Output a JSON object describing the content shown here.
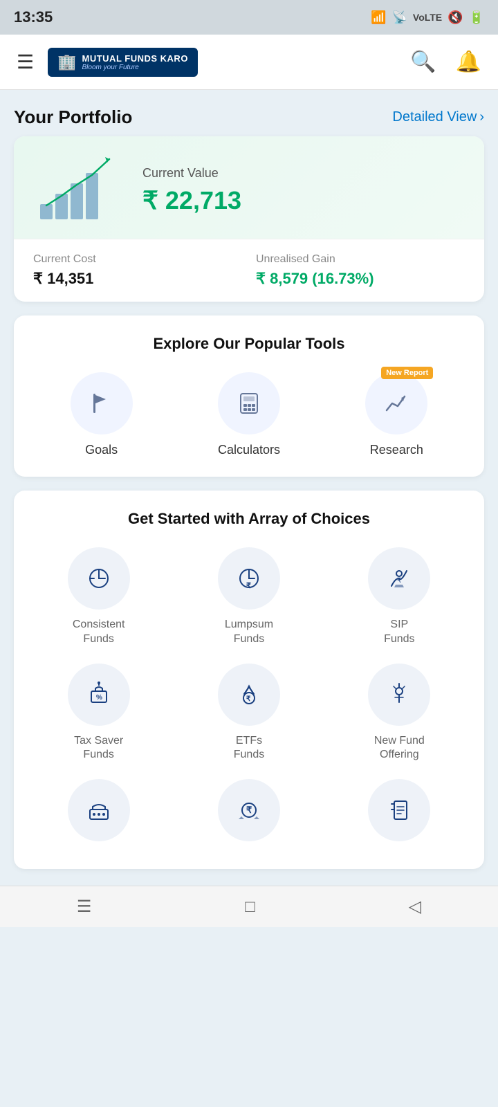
{
  "statusBar": {
    "time": "13:35",
    "icons": [
      "signal",
      "wifi",
      "lte",
      "mute",
      "battery"
    ]
  },
  "topNav": {
    "logoName": "MUTUAL FUNDS KARO",
    "logoTagline": "Bloom your Future",
    "hamburgerLabel": "≡",
    "searchLabel": "🔍",
    "bellLabel": "🔔"
  },
  "portfolio": {
    "sectionTitle": "Your Portfolio",
    "detailedView": "Detailed View",
    "currentValueLabel": "Current Value",
    "currentValue": "₹ 22,713",
    "currentCostLabel": "Current Cost",
    "currentCost": "₹ 14,351",
    "unrealisedGainLabel": "Unrealised Gain",
    "unrealisedGain": "₹ 8,579 (16.73%)"
  },
  "tools": {
    "sectionTitle": "Explore Our Popular Tools",
    "items": [
      {
        "id": "goals",
        "label": "Goals",
        "icon": "🚩",
        "badge": null
      },
      {
        "id": "calculators",
        "label": "Calculators",
        "icon": "📊",
        "badge": null
      },
      {
        "id": "research",
        "label": "Research",
        "icon": "📈",
        "badge": "New Report"
      }
    ]
  },
  "choices": {
    "sectionTitle": "Get Started with Array of Choices",
    "items": [
      {
        "id": "consistent-funds",
        "label": "Consistent Funds",
        "icon": "📉"
      },
      {
        "id": "lumpsum-funds",
        "label": "Lumpsum Funds",
        "icon": "⏱"
      },
      {
        "id": "sip-funds",
        "label": "SIP Funds",
        "icon": "🙌"
      },
      {
        "id": "tax-saver",
        "label": "Tax Saver Funds",
        "icon": "💹"
      },
      {
        "id": "etfs",
        "label": "ETFs Funds",
        "icon": "🪙"
      },
      {
        "id": "nfo",
        "label": "New Fund Offering",
        "icon": "🌱"
      },
      {
        "id": "item7",
        "label": "",
        "icon": "🏦"
      },
      {
        "id": "item8",
        "label": "",
        "icon": "💰"
      },
      {
        "id": "item9",
        "label": "",
        "icon": "📋"
      }
    ]
  },
  "bottomNav": {
    "icons": [
      "≡",
      "□",
      "◁"
    ]
  }
}
